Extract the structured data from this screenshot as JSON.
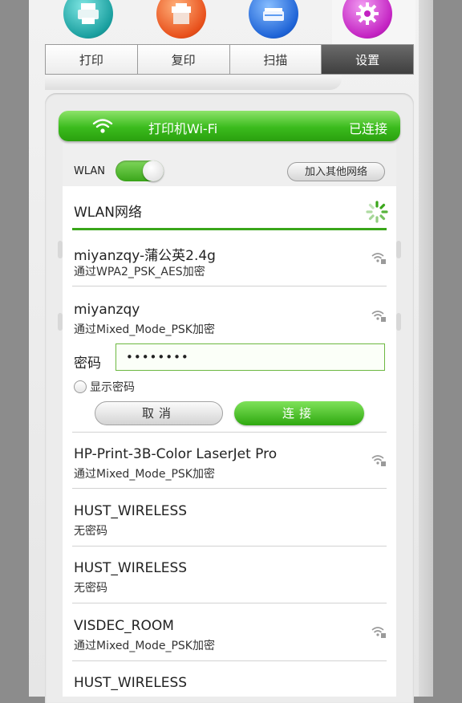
{
  "tabs": [
    {
      "label": "打印",
      "icon": "printer-icon",
      "active": false
    },
    {
      "label": "复印",
      "icon": "copier-icon",
      "active": false
    },
    {
      "label": "扫描",
      "icon": "scanner-icon",
      "active": false
    },
    {
      "label": "设置",
      "icon": "gear-icon",
      "active": true
    }
  ],
  "wifi_header": {
    "icon": "wifi-icon",
    "title": "打印机Wi-Fi",
    "status": "已连接"
  },
  "wlan": {
    "label": "WLAN",
    "toggle_on": true,
    "join_other_label": "加入其他网络"
  },
  "section": {
    "title": "WLAN网络",
    "spinner_icon": "loading-spinner-icon"
  },
  "networks": [
    {
      "name": "miyanzqy-蒲公英2.4g",
      "security": "通过WPA2_PSK_AES加密",
      "signal_icon": "wifi-lock-icon"
    },
    {
      "name": "miyanzqy",
      "security": "通过Mixed_Mode_PSK加密",
      "signal_icon": "wifi-lock-icon"
    },
    {
      "name": "HP-Print-3B-Color LaserJet Pro",
      "security": "通过Mixed_Mode_PSK加密",
      "signal_icon": "wifi-lock-icon"
    },
    {
      "name": "HUST_WIRELESS",
      "security": "无密码",
      "signal_icon": ""
    },
    {
      "name": "HUST_WIRELESS",
      "security": "无密码",
      "signal_icon": ""
    },
    {
      "name": "VISDEC_ROOM",
      "security": "通过Mixed_Mode_PSK加密",
      "signal_icon": "wifi-lock-icon"
    },
    {
      "name": "HUST_WIRELESS",
      "security": "",
      "signal_icon": ""
    }
  ],
  "password_form": {
    "label": "密码",
    "value": "••••••••",
    "show_password_label": "显示密码",
    "cancel_label": "取消",
    "connect_label": "连接"
  },
  "colors": {
    "accent_green": "#3bbb1d",
    "active_tab": "#4a4a4a"
  }
}
